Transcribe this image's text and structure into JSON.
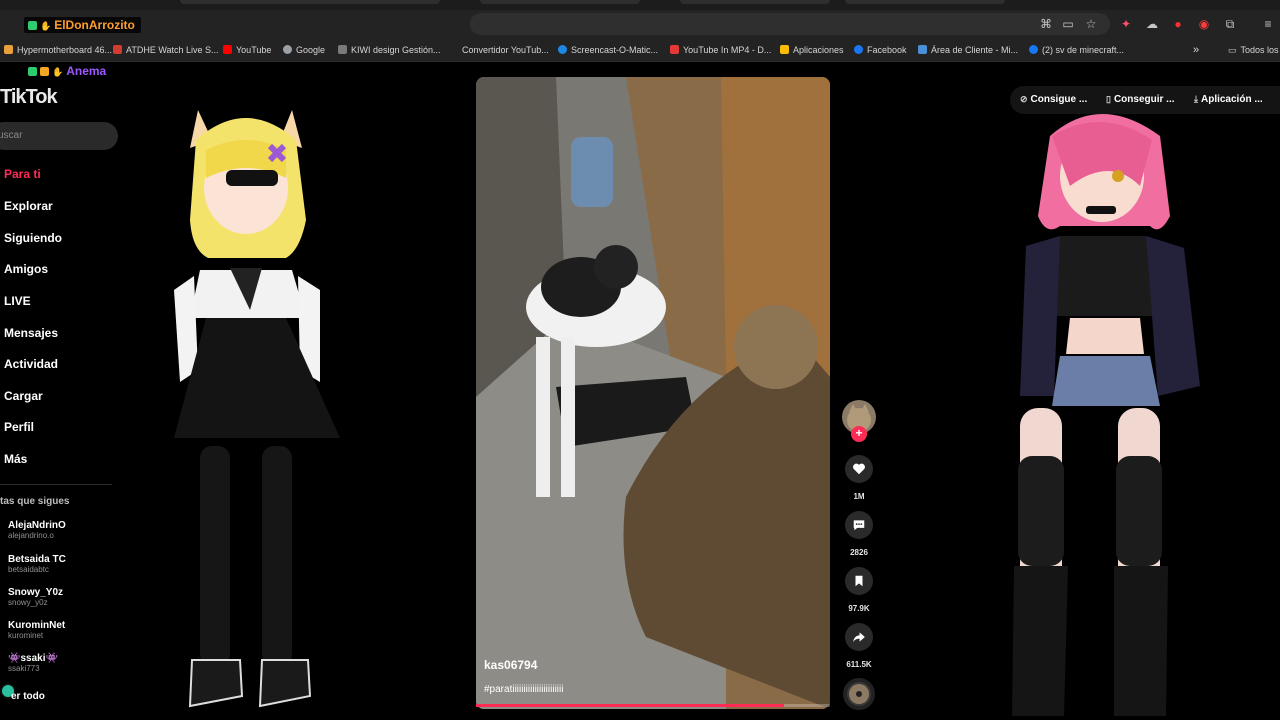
{
  "browser": {
    "bookmarks": [
      {
        "label": "Hypermotherboard 46...",
        "color": "#e8a13a"
      },
      {
        "label": "ATDHE Watch Live S...",
        "color": "#d23b2f"
      },
      {
        "label": "YouTube",
        "color": "#ff0000"
      },
      {
        "label": "Google",
        "color": "#9aa0a6"
      },
      {
        "label": "KIWI design Gestión...",
        "color": "#7a7a7a"
      },
      {
        "label": "Convertidor YouTub...",
        "color": "#3b3b3b"
      },
      {
        "label": "Screencast-O-Matic...",
        "color": "#1e88e5"
      },
      {
        "label": "YouTube In MP4 - D...",
        "color": "#e53935"
      },
      {
        "label": "Aplicaciones",
        "color": "#fbbc05"
      },
      {
        "label": "Facebook",
        "color": "#1877f2"
      },
      {
        "label": "Área de Cliente - Mi...",
        "color": "#4a90d9"
      },
      {
        "label": "(2) sv de minecraft...",
        "color": "#1877f2"
      }
    ],
    "more_bookmarks": "»",
    "all_bookmarks": "Todos los"
  },
  "chat": [
    {
      "user": "ElDonArrozito",
      "color": "#ff9d2e"
    },
    {
      "user": "Anema",
      "color": "#9b59ff"
    }
  ],
  "tiktok": {
    "logo": "TikTok",
    "search_placeholder": "uscar",
    "nav": [
      {
        "label": "Para ti",
        "active": true
      },
      {
        "label": "Explorar"
      },
      {
        "label": "Siguiendo"
      },
      {
        "label": "Amigos"
      },
      {
        "label": "LIVE"
      },
      {
        "label": "Mensajes"
      },
      {
        "label": "Actividad"
      },
      {
        "label": "Cargar"
      },
      {
        "label": "Perfil"
      },
      {
        "label": "Más"
      }
    ],
    "following_header": "tas que sigues",
    "accounts": [
      {
        "name": "AlejaNdrinO",
        "handle": "alejandrino.o"
      },
      {
        "name": "Betsaida TC",
        "handle": "betsaidabtc"
      },
      {
        "name": "Snowy_Y0z",
        "handle": "snowy_y0z"
      },
      {
        "name": "KurominNet",
        "handle": "kurominet"
      },
      {
        "name": "👾ssaki👾",
        "handle": "ssaki773"
      }
    ],
    "see_all": "er todo"
  },
  "video": {
    "username": "kas06794",
    "caption": "#paratiiiiiiiiiiiiiiiiiiiiiii",
    "progress": 0.87
  },
  "actions": {
    "likes": "1M",
    "comments": "2826",
    "saves": "97.9K",
    "shares": "611.5K"
  },
  "header_buttons": [
    {
      "label": "Consigue ...",
      "icon": "coin-icon"
    },
    {
      "label": "Conseguir ...",
      "icon": "phone-icon"
    },
    {
      "label": "Aplicación ...",
      "icon": "download-icon"
    }
  ]
}
